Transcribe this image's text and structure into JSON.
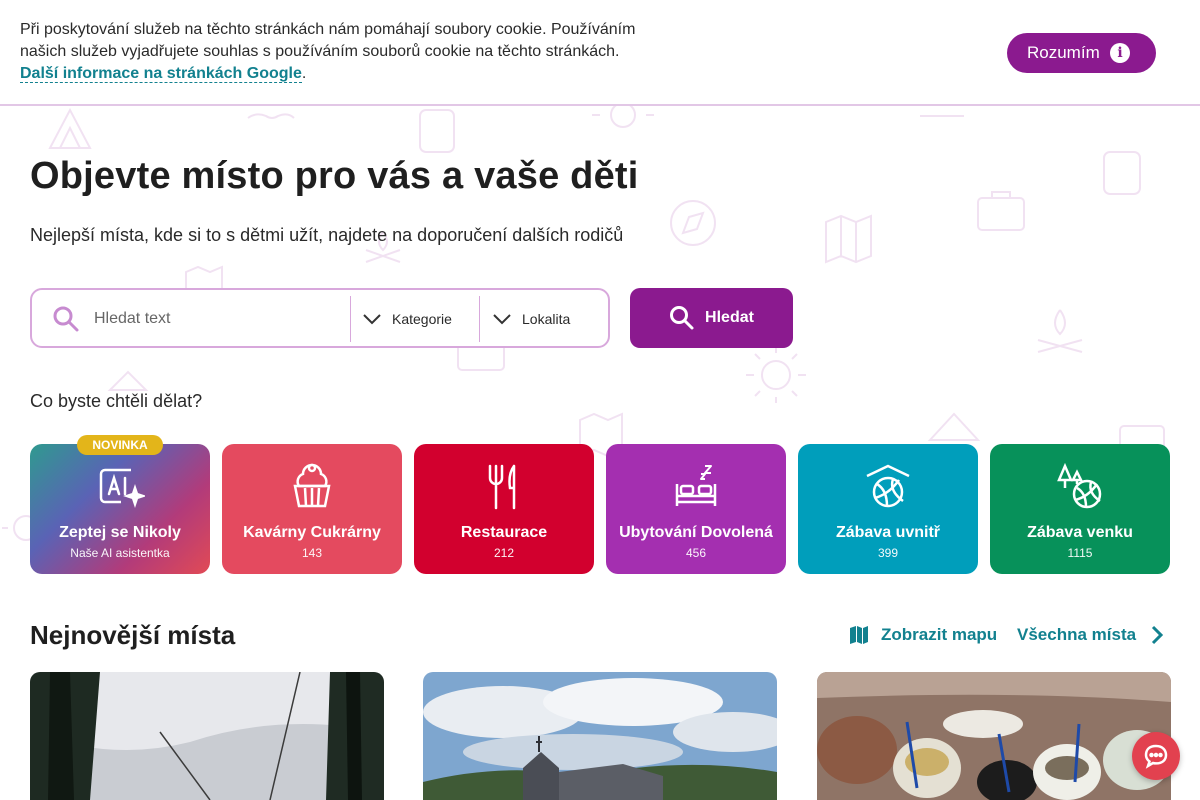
{
  "cookie": {
    "text": "Při poskytování služeb na těchto stránkách nám pomáhají soubory cookie. Používáním našich služeb vyjadřujete souhlas s používáním souborů cookie na těchto stránkách.",
    "link_text": "Další informace na stránkách Google",
    "trailing": ".",
    "accept_label": "Rozumím"
  },
  "hero": {
    "title": "Objevte místo pro vás a vaše děti",
    "subtitle": "Nejlepší místa, kde si to s dětmi užít, najdete na doporučení dalších rodičů"
  },
  "search": {
    "placeholder": "Hledat text",
    "category_label": "Kategorie",
    "location_label": "Lokalita",
    "button_label": "Hledat"
  },
  "question": "Co byste chtěli dělat?",
  "categories": [
    {
      "title": "Zeptej se Nikoly",
      "count": "Naše AI asistentka",
      "badge": "NOVINKA",
      "icon": "ai-sparkle-icon"
    },
    {
      "title": "Kavárny Cukrárny",
      "count": "143",
      "color": "#e44a5f",
      "icon": "cupcake-icon"
    },
    {
      "title": "Restaurace",
      "count": "212",
      "color": "#d2002e",
      "icon": "fork-knife-icon"
    },
    {
      "title": "Ubytování Dovolená",
      "count": "456",
      "color": "#a42fb0",
      "icon": "bed-icon"
    },
    {
      "title": "Zábava uvnitř",
      "count": "399",
      "color": "#009ebb",
      "icon": "indoor-ball-icon"
    },
    {
      "title": "Zábava venku",
      "count": "1115",
      "color": "#07915a",
      "icon": "outdoor-ball-icon"
    }
  ],
  "newest": {
    "title": "Nejnovější místa",
    "map_link": "Zobrazit mapu",
    "all_link": "Všechna místa"
  },
  "colors": {
    "brand_purple": "#8b1a8f",
    "link_teal": "#12818f",
    "chat_red": "#e2414f"
  }
}
